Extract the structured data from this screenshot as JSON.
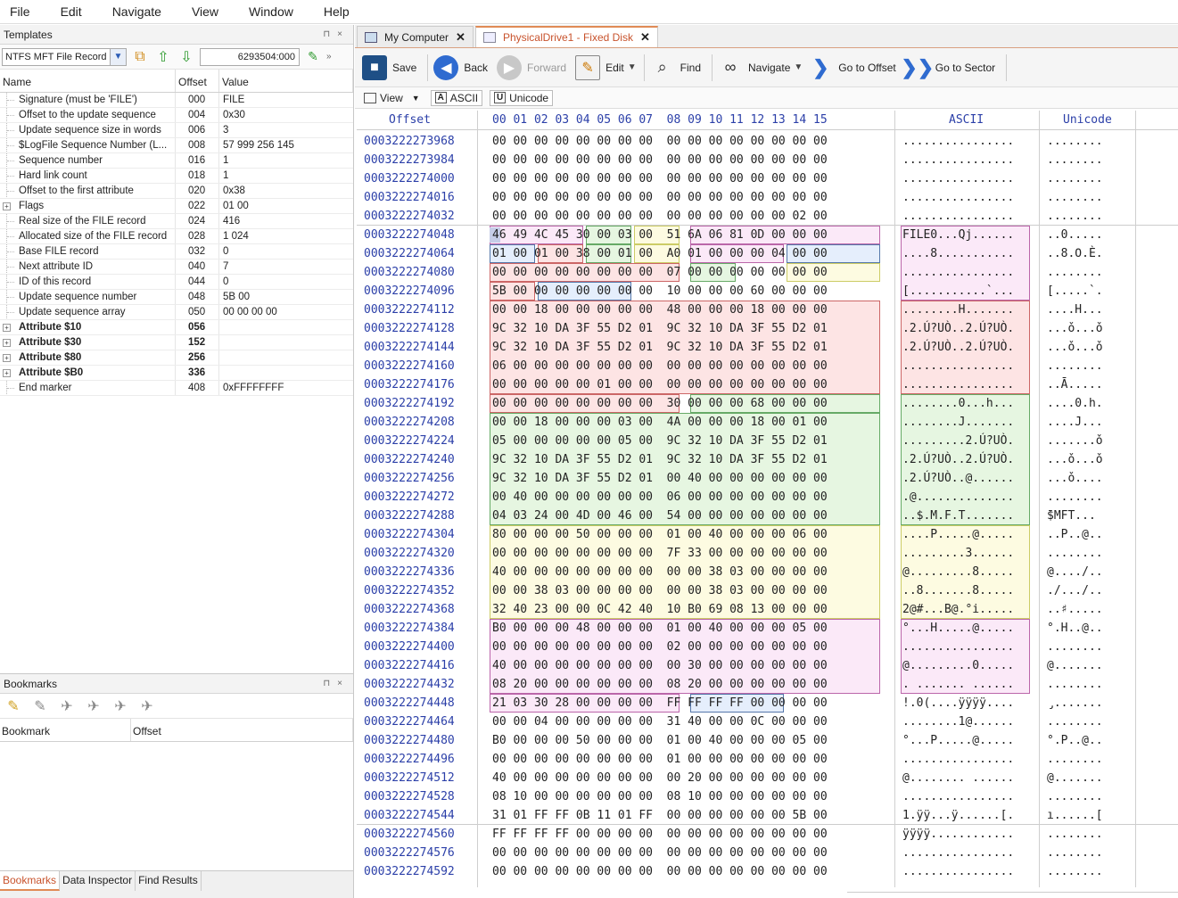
{
  "menu": [
    "File",
    "Edit",
    "Navigate",
    "View",
    "Window",
    "Help"
  ],
  "templates_panel": {
    "title": "Templates",
    "template_select": "NTFS MFT File Record",
    "offset_value": "6293504:000",
    "columns": [
      "Name",
      "Offset",
      "Value"
    ],
    "rows": [
      {
        "name": "Signature (must be 'FILE')",
        "offset": "000",
        "value": "FILE",
        "bold": false,
        "expander": false
      },
      {
        "name": "Offset to the update sequence",
        "offset": "004",
        "value": "0x30",
        "bold": false,
        "expander": false
      },
      {
        "name": "Update sequence size in words",
        "offset": "006",
        "value": "3",
        "bold": false,
        "expander": false
      },
      {
        "name": "$LogFile Sequence Number (L...",
        "offset": "008",
        "value": "57 999 256 145",
        "bold": false,
        "expander": false
      },
      {
        "name": "Sequence number",
        "offset": "016",
        "value": "1",
        "bold": false,
        "expander": false
      },
      {
        "name": "Hard link count",
        "offset": "018",
        "value": "1",
        "bold": false,
        "expander": false
      },
      {
        "name": "Offset to the first attribute",
        "offset": "020",
        "value": "0x38",
        "bold": false,
        "expander": false
      },
      {
        "name": "Flags",
        "offset": "022",
        "value": "01 00",
        "bold": false,
        "expander": true
      },
      {
        "name": "Real size of the FILE record",
        "offset": "024",
        "value": "416",
        "bold": false,
        "expander": false
      },
      {
        "name": "Allocated size of the FILE record",
        "offset": "028",
        "value": "1 024",
        "bold": false,
        "expander": false
      },
      {
        "name": "Base FILE record",
        "offset": "032",
        "value": "0",
        "bold": false,
        "expander": false
      },
      {
        "name": "Next attribute ID",
        "offset": "040",
        "value": "7",
        "bold": false,
        "expander": false
      },
      {
        "name": "ID of this record",
        "offset": "044",
        "value": "0",
        "bold": false,
        "expander": false
      },
      {
        "name": "Update sequence number",
        "offset": "048",
        "value": "5B 00",
        "bold": false,
        "expander": false
      },
      {
        "name": "Update sequence array",
        "offset": "050",
        "value": "00 00 00 00",
        "bold": false,
        "expander": false
      },
      {
        "name": "Attribute $10",
        "offset": "056",
        "value": "",
        "bold": true,
        "expander": true
      },
      {
        "name": "Attribute $30",
        "offset": "152",
        "value": "",
        "bold": true,
        "expander": true
      },
      {
        "name": "Attribute $80",
        "offset": "256",
        "value": "",
        "bold": true,
        "expander": true
      },
      {
        "name": "Attribute $B0",
        "offset": "336",
        "value": "",
        "bold": true,
        "expander": true
      },
      {
        "name": "End marker",
        "offset": "408",
        "value": "0xFFFFFFFF",
        "bold": false,
        "expander": false
      }
    ]
  },
  "bookmarks_panel": {
    "title": "Bookmarks",
    "columns": [
      "Bookmark",
      "Offset"
    ]
  },
  "bottom_tabs": [
    "Bookmarks",
    "Data Inspector",
    "Find Results"
  ],
  "doc_tabs": [
    {
      "label": "My Computer",
      "active": false
    },
    {
      "label": "PhysicalDrive1 - Fixed Disk",
      "active": true
    }
  ],
  "toolbar": {
    "save": "Save",
    "back": "Back",
    "forward": "Forward",
    "edit": "Edit",
    "find": "Find",
    "navigate": "Navigate",
    "goto_offset": "Go to Offset",
    "goto_sector": "Go to Sector"
  },
  "view_bar": {
    "view": "View",
    "ascii": "ASCII",
    "unicode": "Unicode"
  },
  "hex": {
    "header_offset": "Offset",
    "header_bytes": [
      "00",
      "01",
      "02",
      "03",
      "04",
      "05",
      "06",
      "07",
      "08",
      "09",
      "10",
      "11",
      "12",
      "13",
      "14",
      "15"
    ],
    "header_ascii": "ASCII",
    "header_unicode": "Unicode",
    "rows": [
      {
        "off": "0003222273968",
        "hex": "00 00 00 00 00 00 00 00  00 00 00 00 00 00 00 00",
        "asc": "................",
        "uni": "........"
      },
      {
        "off": "0003222273984",
        "hex": "00 00 00 00 00 00 00 00  00 00 00 00 00 00 00 00",
        "asc": "................",
        "uni": "........"
      },
      {
        "off": "0003222274000",
        "hex": "00 00 00 00 00 00 00 00  00 00 00 00 00 00 00 00",
        "asc": "................",
        "uni": "........"
      },
      {
        "off": "0003222274016",
        "hex": "00 00 00 00 00 00 00 00  00 00 00 00 00 00 00 00",
        "asc": "................",
        "uni": "........"
      },
      {
        "off": "0003222274032",
        "hex": "00 00 00 00 00 00 00 00  00 00 00 00 00 00 02 00",
        "asc": "................",
        "uni": "........"
      },
      {
        "off": "0003222274048",
        "hex": "46 49 4C 45 30 00 03 00  51 6A 06 81 0D 00 00 00",
        "asc": "FILE0...Qj......",
        "uni": "..0....."
      },
      {
        "off": "0003222274064",
        "hex": "01 00 01 00 38 00 01 00  A0 01 00 00 00 04 00 00",
        "asc": "....8...........",
        "uni": "..8.Ο.È."
      },
      {
        "off": "0003222274080",
        "hex": "00 00 00 00 00 00 00 00  07 00 00 00 00 00 00 00",
        "asc": "................",
        "uni": "........"
      },
      {
        "off": "0003222274096",
        "hex": "5B 00 00 00 00 00 00 00  10 00 00 00 60 00 00 00",
        "asc": "[...........`...",
        "uni": "[.....`."
      },
      {
        "off": "0003222274112",
        "hex": "00 00 18 00 00 00 00 00  48 00 00 00 18 00 00 00",
        "asc": "........H.......",
        "uni": "....H..."
      },
      {
        "off": "0003222274128",
        "hex": "9C 32 10 DA 3F 55 D2 01  9C 32 10 DA 3F 55 D2 01",
        "asc": ".2.Ú?UÒ..2.Ú?UÒ.",
        "uni": "...ǒ...ǒ"
      },
      {
        "off": "0003222274144",
        "hex": "9C 32 10 DA 3F 55 D2 01  9C 32 10 DA 3F 55 D2 01",
        "asc": ".2.Ú?UÒ..2.Ú?UÒ.",
        "uni": "...ǒ...ǒ"
      },
      {
        "off": "0003222274160",
        "hex": "06 00 00 00 00 00 00 00  00 00 00 00 00 00 00 00",
        "asc": "................",
        "uni": "........"
      },
      {
        "off": "0003222274176",
        "hex": "00 00 00 00 00 01 00 00  00 00 00 00 00 00 00 00",
        "asc": "................",
        "uni": "..Ā....."
      },
      {
        "off": "0003222274192",
        "hex": "00 00 00 00 00 00 00 00  30 00 00 00 68 00 00 00",
        "asc": "........0...h...",
        "uni": "....0.h."
      },
      {
        "off": "0003222274208",
        "hex": "00 00 18 00 00 00 03 00  4A 00 00 00 18 00 01 00",
        "asc": "........J.......",
        "uni": "....J..."
      },
      {
        "off": "0003222274224",
        "hex": "05 00 00 00 00 00 05 00  9C 32 10 DA 3F 55 D2 01",
        "asc": ".........2.Ú?UÒ.",
        "uni": ".......ǒ"
      },
      {
        "off": "0003222274240",
        "hex": "9C 32 10 DA 3F 55 D2 01  9C 32 10 DA 3F 55 D2 01",
        "asc": ".2.Ú?UÒ..2.Ú?UÒ.",
        "uni": "...ǒ...ǒ"
      },
      {
        "off": "0003222274256",
        "hex": "9C 32 10 DA 3F 55 D2 01  00 40 00 00 00 00 00 00",
        "asc": ".2.Ú?UÒ..@......",
        "uni": "...ǒ...."
      },
      {
        "off": "0003222274272",
        "hex": "00 40 00 00 00 00 00 00  06 00 00 00 00 00 00 00",
        "asc": ".@..............",
        "uni": "........"
      },
      {
        "off": "0003222274288",
        "hex": "04 03 24 00 4D 00 46 00  54 00 00 00 00 00 00 00",
        "asc": "..$.M.F.T.......",
        "uni": "̄$MFT..."
      },
      {
        "off": "0003222274304",
        "hex": "80 00 00 00 50 00 00 00  01 00 40 00 00 00 06 00",
        "asc": "....P.....@.....",
        "uni": "..P..@.."
      },
      {
        "off": "0003222274320",
        "hex": "00 00 00 00 00 00 00 00  7F 33 00 00 00 00 00 00",
        "asc": ".........3......",
        "uni": "........"
      },
      {
        "off": "0003222274336",
        "hex": "40 00 00 00 00 00 00 00  00 00 38 03 00 00 00 00",
        "asc": "@.........8.....",
        "uni": "@..../.."
      },
      {
        "off": "0003222274352",
        "hex": "00 00 38 03 00 00 00 00  00 00 38 03 00 00 00 00",
        "asc": "..8.......8.....",
        "uni": "./.../.."
      },
      {
        "off": "0003222274368",
        "hex": "32 40 23 00 00 0C 42 40  10 B0 69 08 13 00 00 00",
        "asc": "2@#...B@.°i.....",
        "uni": "..♯....."
      },
      {
        "off": "0003222274384",
        "hex": "B0 00 00 00 48 00 00 00  01 00 40 00 00 00 05 00",
        "asc": "°...H.....@.....",
        "uni": "°.H..@.."
      },
      {
        "off": "0003222274400",
        "hex": "00 00 00 00 00 00 00 00  02 00 00 00 00 00 00 00",
        "asc": "................",
        "uni": "........"
      },
      {
        "off": "0003222274416",
        "hex": "40 00 00 00 00 00 00 00  00 30 00 00 00 00 00 00",
        "asc": "@.........0.....",
        "uni": "@......."
      },
      {
        "off": "0003222274432",
        "hex": "08 20 00 00 00 00 00 00  08 20 00 00 00 00 00 00",
        "asc": ". ....... ......",
        "uni": "........"
      },
      {
        "off": "0003222274448",
        "hex": "21 03 30 28 00 00 00 00  FF FF FF FF 00 00 00 00",
        "asc": "!.0(....ÿÿÿÿ....",
        "uni": "̡......."
      },
      {
        "off": "0003222274464",
        "hex": "00 00 04 00 00 00 00 00  31 40 00 00 0C 00 00 00",
        "asc": "........1@......",
        "uni": "........"
      },
      {
        "off": "0003222274480",
        "hex": "B0 00 00 00 50 00 00 00  01 00 40 00 00 00 05 00",
        "asc": "°...P.....@.....",
        "uni": "°.P..@.."
      },
      {
        "off": "0003222274496",
        "hex": "00 00 00 00 00 00 00 00  01 00 00 00 00 00 00 00",
        "asc": "................",
        "uni": "........"
      },
      {
        "off": "0003222274512",
        "hex": "40 00 00 00 00 00 00 00  00 20 00 00 00 00 00 00",
        "asc": "@........ ......",
        "uni": "@......."
      },
      {
        "off": "0003222274528",
        "hex": "08 10 00 00 00 00 00 00  08 10 00 00 00 00 00 00",
        "asc": "................",
        "uni": "........"
      },
      {
        "off": "0003222274544",
        "hex": "31 01 FF FF 0B 11 01 FF  00 00 00 00 00 00 5B 00",
        "asc": "1.ÿÿ...ÿ......[.",
        "uni": "ı......["
      },
      {
        "off": "0003222274560",
        "hex": "FF FF FF FF 00 00 00 00  00 00 00 00 00 00 00 00",
        "asc": "ÿÿÿÿ............",
        "uni": "........"
      },
      {
        "off": "0003222274576",
        "hex": "00 00 00 00 00 00 00 00  00 00 00 00 00 00 00 00",
        "asc": "................",
        "uni": "........"
      },
      {
        "off": "0003222274592",
        "hex": "00 00 00 00 00 00 00 00  00 00 00 00 00 00 00 00",
        "asc": "................",
        "uni": "........"
      }
    ]
  },
  "colors": {
    "accent": "#c8532d",
    "offset_blue": "#2b3fa8"
  }
}
